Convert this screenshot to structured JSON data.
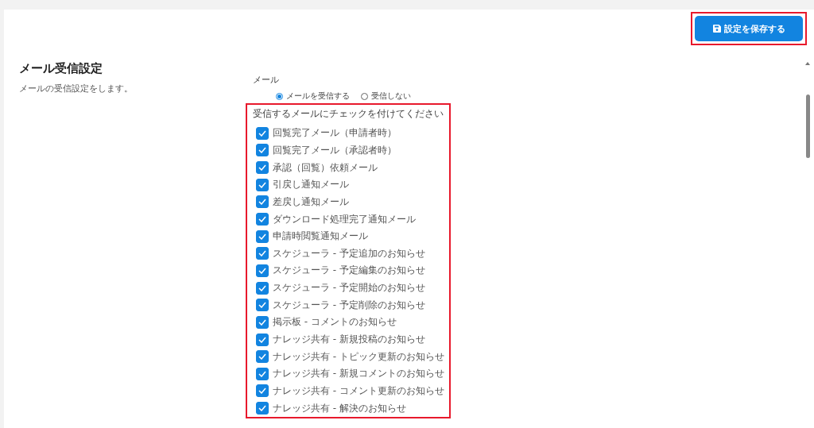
{
  "save_button": {
    "label": "設定を保存する",
    "highlighted": true
  },
  "section": {
    "title": "メール受信設定",
    "description": "メールの受信設定をします。"
  },
  "mail": {
    "label": "メール",
    "options": [
      {
        "label": "メールを受信する",
        "selected": true
      },
      {
        "label": "受信しない",
        "selected": false
      }
    ],
    "checklist": {
      "highlighted": true,
      "instruction": "受信するメールにチェックを付けてください",
      "items": [
        {
          "label": "回覧完了メール（申請者時）",
          "checked": true
        },
        {
          "label": "回覧完了メール（承認者時）",
          "checked": true
        },
        {
          "label": "承認（回覧）依頼メール",
          "checked": true
        },
        {
          "label": "引戻し通知メール",
          "checked": true
        },
        {
          "label": "差戻し通知メール",
          "checked": true
        },
        {
          "label": "ダウンロード処理完了通知メール",
          "checked": true
        },
        {
          "label": "申請時閲覧通知メール",
          "checked": true
        },
        {
          "label": "スケジューラ - 予定追加のお知らせ",
          "checked": true
        },
        {
          "label": "スケジューラ - 予定編集のお知らせ",
          "checked": true
        },
        {
          "label": "スケジューラ - 予定開始のお知らせ",
          "checked": true
        },
        {
          "label": "スケジューラ - 予定削除のお知らせ",
          "checked": true
        },
        {
          "label": "掲示板 - コメントのお知らせ",
          "checked": true
        },
        {
          "label": "ナレッジ共有 - 新規投稿のお知らせ",
          "checked": true
        },
        {
          "label": "ナレッジ共有 - トピック更新のお知らせ",
          "checked": true
        },
        {
          "label": "ナレッジ共有 - 新規コメントのお知らせ",
          "checked": true
        },
        {
          "label": "ナレッジ共有 - コメント更新のお知らせ",
          "checked": true
        },
        {
          "label": "ナレッジ共有 - 解決のお知らせ",
          "checked": true
        }
      ]
    }
  }
}
